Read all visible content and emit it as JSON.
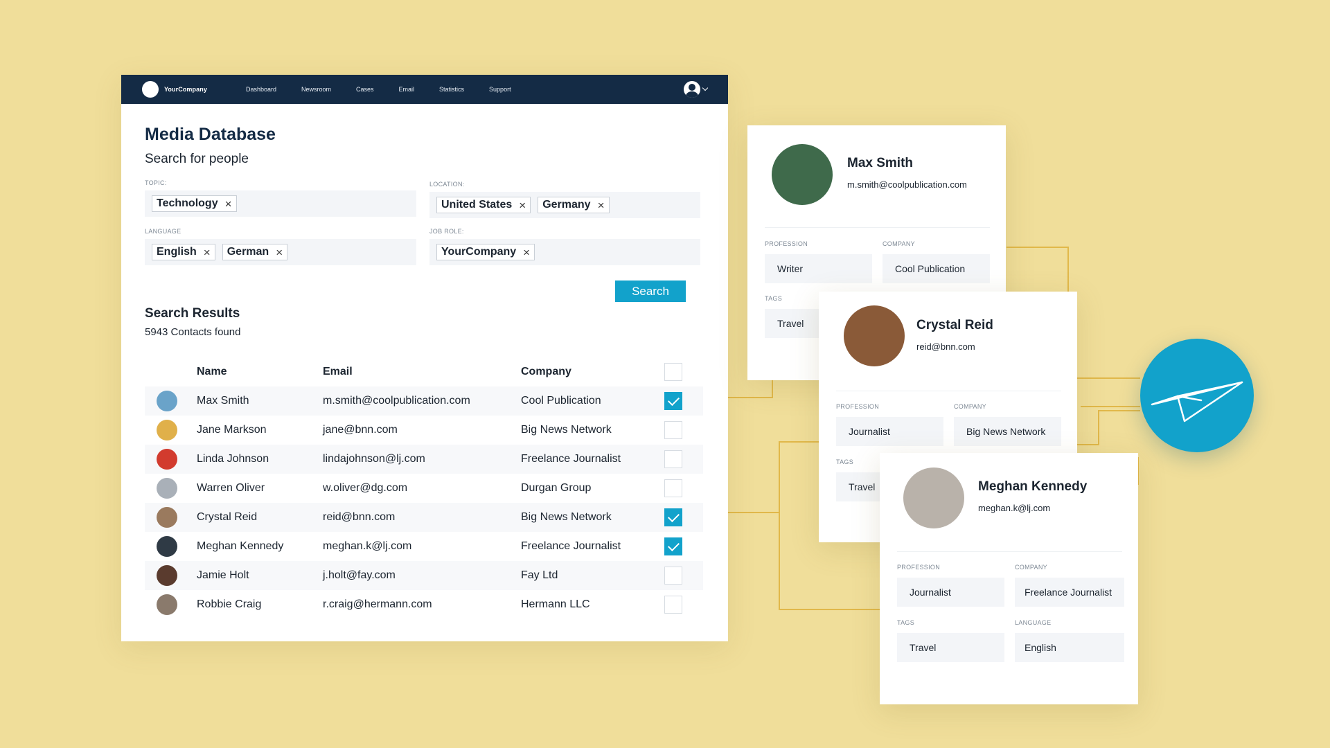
{
  "nav": {
    "company": "YourCompany",
    "items": [
      "Dashboard",
      "Newsroom",
      "Cases",
      "Email",
      "Statistics",
      "Support"
    ]
  },
  "page": {
    "title": "Media Database",
    "subtitle": "Search for people"
  },
  "filters": {
    "topic": {
      "label": "TOPIC:",
      "chips": [
        "Technology"
      ]
    },
    "location": {
      "label": "LOCATION:",
      "chips": [
        "United States",
        "Germany"
      ]
    },
    "language": {
      "label": "LANGUAGE",
      "chips": [
        "English",
        "German"
      ]
    },
    "job_role": {
      "label": "JOB ROLE:",
      "chips": [
        "YourCompany"
      ]
    },
    "search_label": "Search"
  },
  "results": {
    "title": "Search Results",
    "count": "5943 Contacts found",
    "columns": {
      "name": "Name",
      "email": "Email",
      "company": "Company"
    },
    "rows": [
      {
        "name": "Max Smith",
        "email": "m.smith@coolpublication.com",
        "company": "Cool Publication",
        "checked": true,
        "avatar_color": "#6aa3c9"
      },
      {
        "name": "Jane Markson",
        "email": "jane@bnn.com",
        "company": "Big News Network",
        "checked": false,
        "avatar_color": "#e0b04a"
      },
      {
        "name": "Linda Johnson",
        "email": "lindajohnson@lj.com",
        "company": "Freelance Journalist",
        "checked": false,
        "avatar_color": "#d23b2e"
      },
      {
        "name": "Warren Oliver",
        "email": "w.oliver@dg.com",
        "company": "Durgan Group",
        "checked": false,
        "avatar_color": "#a9b0b8"
      },
      {
        "name": "Crystal Reid",
        "email": "reid@bnn.com",
        "company": "Big News Network",
        "checked": true,
        "avatar_color": "#9a7a5e"
      },
      {
        "name": "Meghan Kennedy",
        "email": "meghan.k@lj.com",
        "company": "Freelance Journalist",
        "checked": true,
        "avatar_color": "#2f3a45"
      },
      {
        "name": "Jamie Holt",
        "email": "j.holt@fay.com",
        "company": "Fay Ltd",
        "checked": false,
        "avatar_color": "#5a3b2e"
      },
      {
        "name": "Robbie Craig",
        "email": "r.craig@hermann.com",
        "company": "Hermann LLC",
        "checked": false,
        "avatar_color": "#8a7a6c"
      }
    ]
  },
  "cards": [
    {
      "name": "Max Smith",
      "email": "m.smith@coolpublication.com",
      "avatar_color": "#3f6a4b",
      "profession_label": "PROFESSION",
      "profession": "Writer",
      "company_label": "COMPANY",
      "company": "Cool Publication",
      "tags_label": "TAGS",
      "tags": "Travel"
    },
    {
      "name": "Crystal Reid",
      "email": "reid@bnn.com",
      "avatar_color": "#8a5a38",
      "profession_label": "PROFESSION",
      "profession": "Journalist",
      "company_label": "COMPANY",
      "company": "Big News Network",
      "tags_label": "TAGS",
      "tags": "Travel"
    },
    {
      "name": "Meghan Kennedy",
      "email": "meghan.k@lj.com",
      "avatar_color": "#b9b2aa",
      "profession_label": "PROFESSION",
      "profession": "Journalist",
      "company_label": "COMPANY",
      "company": "Freelance Journalist",
      "tags_label": "TAGS",
      "tags": "Travel",
      "language_label": "LANGUAGE",
      "language": "English"
    }
  ],
  "colors": {
    "background": "#f0de9a",
    "nav": "#142b45",
    "accent": "#12a2cb",
    "connector": "#e1b84a"
  },
  "icons": {
    "send": "paper-plane-icon",
    "user": "user-circle-icon",
    "remove": "close-icon"
  }
}
